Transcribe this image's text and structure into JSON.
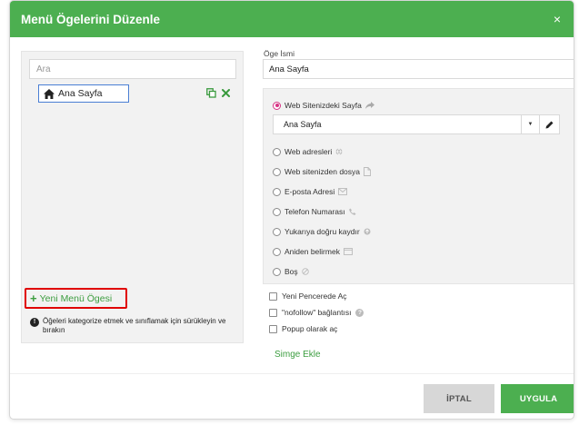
{
  "dialog": {
    "title": "Menü Ögelerini Düzenle",
    "close_symbol": "×",
    "accent_color": "#4caf50"
  },
  "left_panel": {
    "search_placeholder": "Ara",
    "tree_items": [
      {
        "label": "Ana Sayfa",
        "icon": "home-icon",
        "selected": true
      }
    ],
    "item_actions": [
      "copy-icon",
      "remove-icon"
    ],
    "add_button_label": "Yeni Menü Ögesi",
    "add_button_symbol": "+",
    "hint_symbol": "!",
    "hint_text": "Öğeleri kategorize etmek ve sınıflamak için sürükleyin ve bırakın"
  },
  "item_name": {
    "label": "Öge İsmi",
    "value": "Ana Sayfa"
  },
  "link_options": {
    "selected_index": 0,
    "page_select_value": "Ana Sayfa",
    "page_select_caret": "▼",
    "options": [
      {
        "label": "Web Sitenizdeki Sayfa",
        "icon": "share-arrow-icon"
      },
      {
        "label": "Web adresleri",
        "icon": "globe-icon"
      },
      {
        "label": "Web sitenizden dosya",
        "icon": "file-icon"
      },
      {
        "label": "E-posta Adresi",
        "icon": "envelope-icon"
      },
      {
        "label": "Telefon Numarası",
        "icon": "phone-icon"
      },
      {
        "label": "Yukarıya doğru kaydır",
        "icon": "arrow-up-circle-icon"
      },
      {
        "label": "Aniden belirmek",
        "icon": "window-icon"
      },
      {
        "label": "Boş",
        "icon": "slash-circle-icon"
      }
    ]
  },
  "checkboxes": {
    "new_window": "Yeni Pencerede Aç",
    "nofollow": "\"nofollow\" bağlantısı",
    "nofollow_help": "?",
    "popup": "Popup olarak aç"
  },
  "add_icon_link": "Simge Ekle",
  "footer": {
    "cancel_label": "İPTAL",
    "apply_label": "UYGULA"
  }
}
